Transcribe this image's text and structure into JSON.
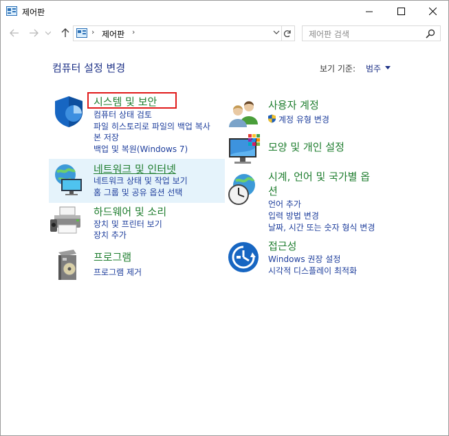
{
  "window": {
    "title": "제어판"
  },
  "address": {
    "path": "제어판"
  },
  "search": {
    "placeholder": "제어판 검색"
  },
  "header": {
    "title": "컴퓨터 설정 변경",
    "view_by_label": "보기 기준:",
    "view_by_value": "범주"
  },
  "categories": [
    {
      "title": "시스템 및 보안",
      "links": [
        "컴퓨터 상태 검토",
        "파일 히스토리로 파일의 백업 복사",
        "본 저장",
        "백업 및 복원(Windows 7)"
      ]
    },
    {
      "title": "네트워크 및 인터넷",
      "links": [
        "네트워크 상태 및 작업 보기",
        "홈 그룹 및 공유 옵션 선택"
      ]
    },
    {
      "title": "하드웨어 및 소리",
      "links": [
        "장치 및 프린터 보기",
        "장치 추가"
      ]
    },
    {
      "title": "프로그램",
      "links": [
        "프로그램 제거"
      ]
    },
    {
      "title": "사용자 계정",
      "links": [
        "계정 유형 변경"
      ]
    },
    {
      "title": "모양 및 개인 설정",
      "links": []
    },
    {
      "title": "시계, 언어 및 국가별 옵",
      "title2": "션",
      "links": [
        "언어 추가",
        "입력 방법 변경",
        "날짜, 시간 또는 숫자 형식 변경"
      ]
    },
    {
      "title": "접근성",
      "links": [
        "Windows 권장 설정",
        "시각적 디스플레이 최적화"
      ]
    }
  ],
  "icons": [
    "control-panel-icon",
    "back-arrow-icon",
    "forward-arrow-icon",
    "up-arrow-icon",
    "refresh-icon",
    "search-icon",
    "shield-icon",
    "network-globe-icon",
    "printer-icon",
    "programs-box-icon",
    "users-icon",
    "display-palette-icon",
    "clock-globe-icon",
    "accessibility-icon"
  ],
  "colors": {
    "category_title": "#1e7d2e",
    "link": "#1e3e9c",
    "heading": "#1e3287",
    "highlight_border": "#e01a1a",
    "hover_bg": "#e5f3fb"
  }
}
